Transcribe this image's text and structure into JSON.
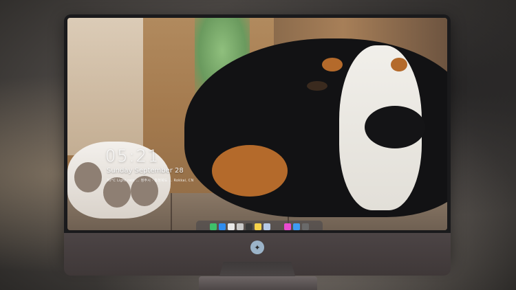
{
  "lockscreen": {
    "time": "05:21",
    "date": "Sunday September 28",
    "weather_line": "30°C  Light rain  ...  청주시 · 충청북도  ...  Rokkai, CN"
  },
  "dock": {
    "icons": [
      {
        "name": "finder-icon",
        "color": "#3ec06a"
      },
      {
        "name": "messages-icon",
        "color": "#2f8df0"
      },
      {
        "name": "safari-icon",
        "color": "#e8e8e8"
      },
      {
        "name": "preview-icon",
        "color": "#c9c9c9"
      },
      {
        "name": "clapper-icon",
        "color": "#3a3a3a"
      },
      {
        "name": "notes-icon",
        "color": "#f6d24a"
      },
      {
        "name": "photos-icon",
        "color": "#b6c9e6"
      },
      {
        "name": "music-icon",
        "color": "#e94bd0"
      },
      {
        "name": "app-store-icon",
        "color": "#3e9cf2"
      },
      {
        "name": "camera-icon",
        "color": "#6a6a6a"
      }
    ]
  }
}
